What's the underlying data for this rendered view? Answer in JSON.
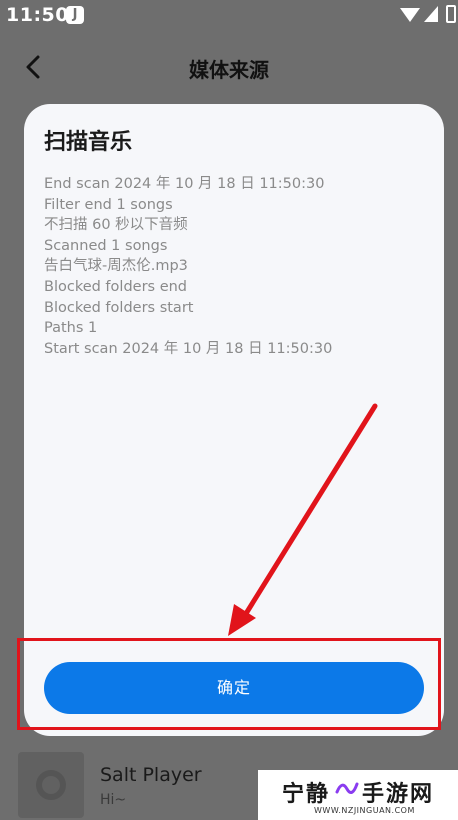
{
  "status_bar": {
    "time": "11:50",
    "app_icon_letter": "J"
  },
  "header": {
    "title": "媒体来源"
  },
  "dialog": {
    "title": "扫描音乐",
    "log_lines": [
      "End scan 2024 年 10 月 18 日 11:50:30",
      "Filter end 1 songs",
      "不扫描 60 秒以下音频",
      "Scanned 1 songs",
      "告白气球-周杰伦.mp3",
      "Blocked folders end",
      "Blocked folders start",
      "Paths 1",
      "Start scan 2024 年 10 月 18 日 11:50:30"
    ],
    "confirm_label": "确定"
  },
  "player": {
    "title": "Salt Player",
    "subtitle": "Hi~"
  },
  "watermark": {
    "cn_left": "宁静",
    "cn_right": "手游网",
    "en": "WWW.NZJINGUAN.COM"
  },
  "colors": {
    "accent": "#0c79e8",
    "highlight": "#e1141b",
    "scrim": "#6e6e6e",
    "dialog_bg": "#f6f7fa"
  }
}
